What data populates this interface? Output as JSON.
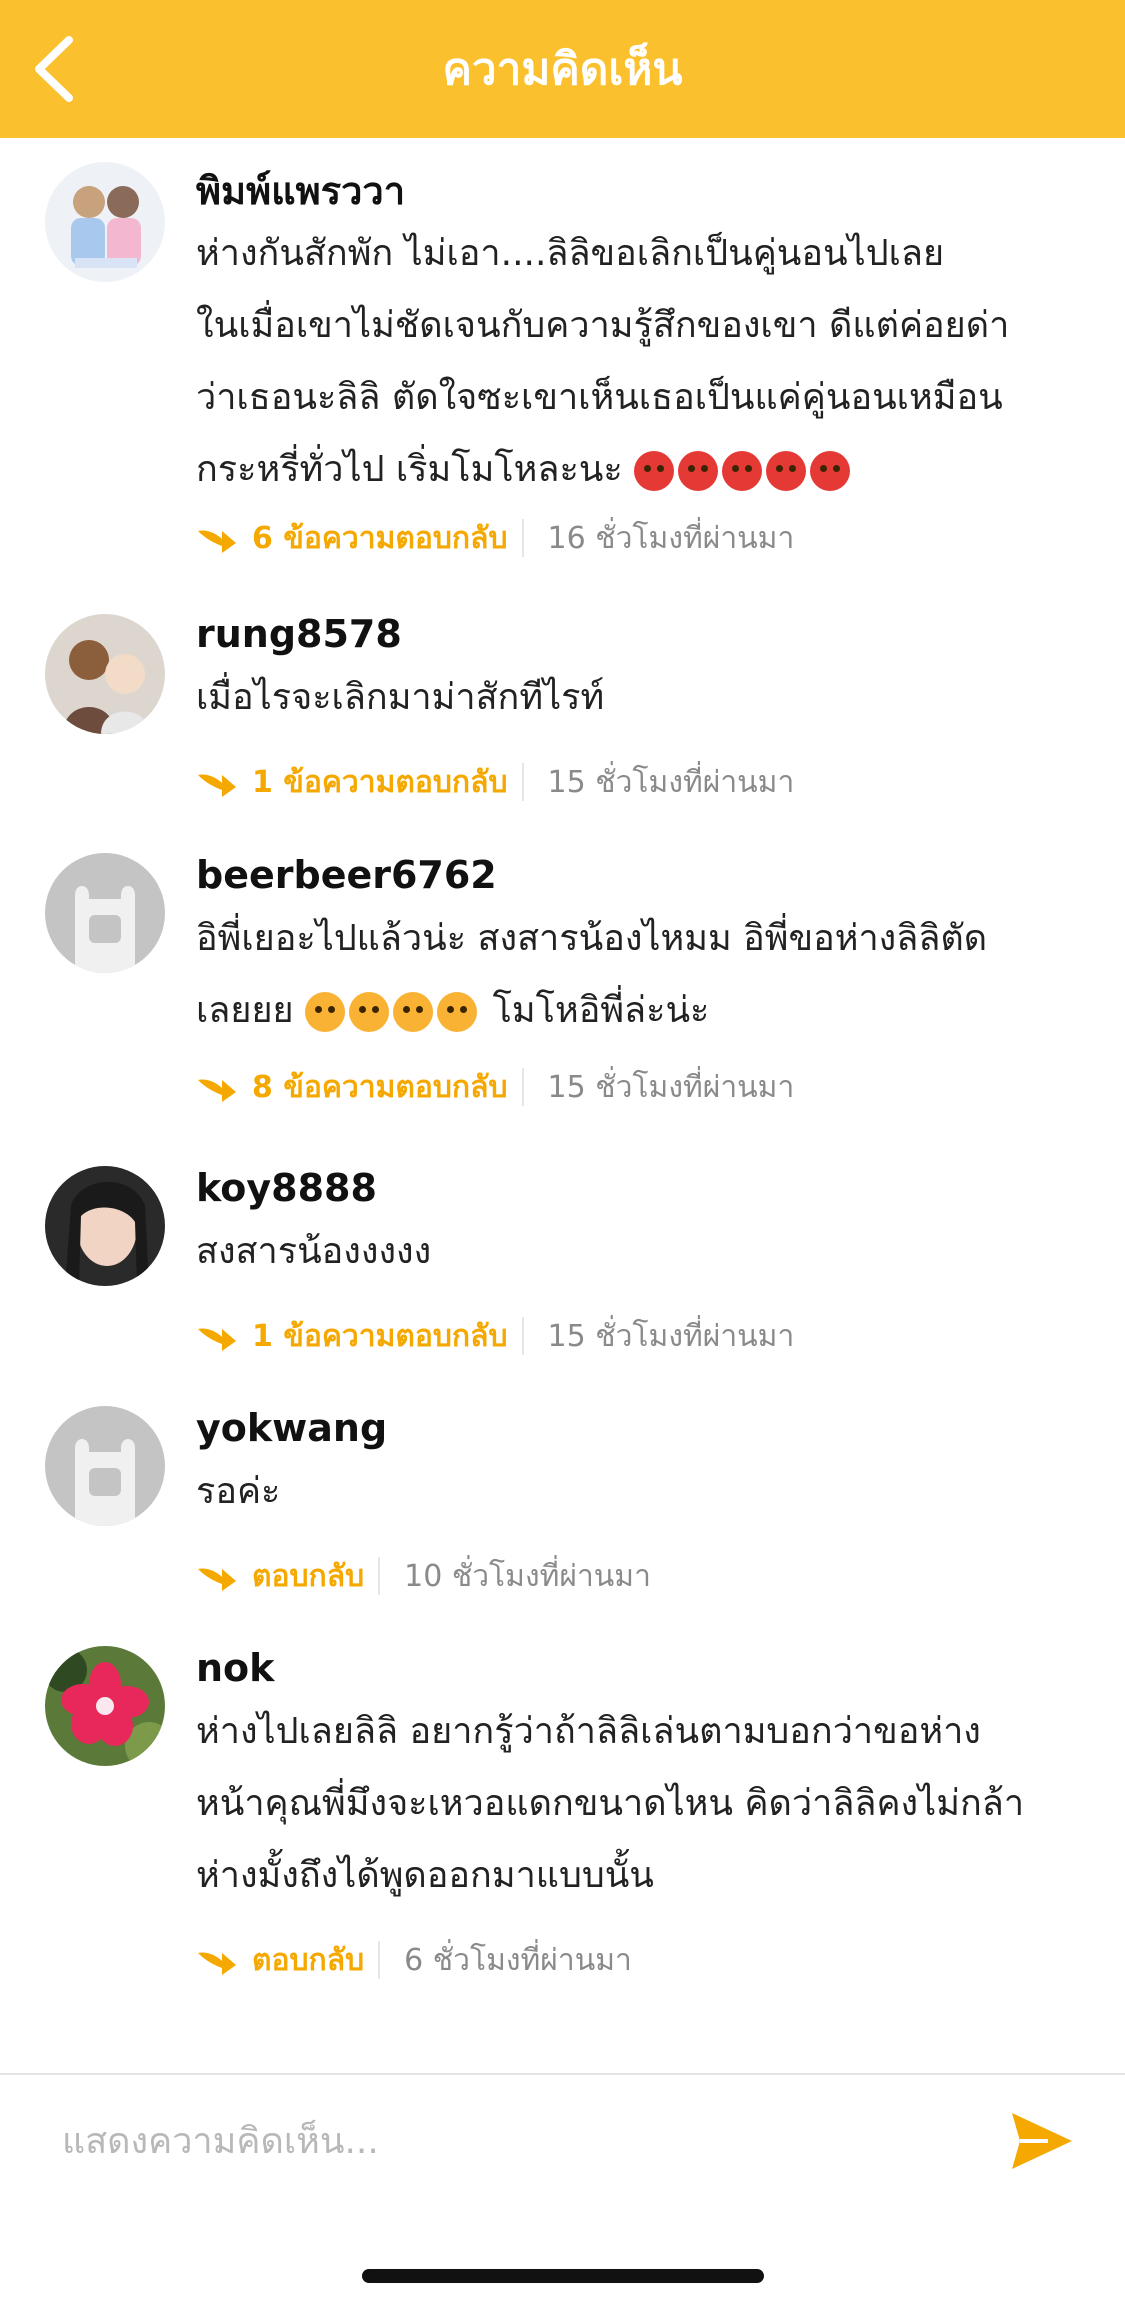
{
  "header": {
    "title": "ความคิดเห็น",
    "back_icon": "chevron-left-icon",
    "background": "#fbc02d"
  },
  "colors": {
    "accent": "#f5a800",
    "muted": "#8a8a8a"
  },
  "comments": [
    {
      "username": "พิมพ์แพรววา",
      "lines": [
        "ห่างกันสักพัก ไม่เอา....ลิลิขอเลิกเป็นคู่นอนไปเลย",
        "ในเมื่อเขาไม่ชัดเจนกับความรู้สึกของเขา ดีแต่ค่อยด่า",
        "ว่าเธอนะลิลิ ตัดใจซะเขาเห็นเธอเป็นแค่คู่นอนเหมือน",
        "กระหรี่ทั่วไป เริ่มโมโหละนะ"
      ],
      "reply_label": "6 ข้อความตอบกลับ",
      "time": "16 ชั่วโมงที่ผ่านมา"
    },
    {
      "username": "rung8578",
      "lines": [
        "เมื่อไรจะเลิกมาม่าสักทีไรท์"
      ],
      "reply_label": "1 ข้อความตอบกลับ",
      "time": "15 ชั่วโมงที่ผ่านมา"
    },
    {
      "username": "beerbeer6762",
      "lines": [
        "อิพี่เยอะไปแล้วน่ะ  สงสารน้องไหมม  อิพี่ขอห่างลิลิตัด",
        "เลยยย"
      ],
      "line2_suffix": "โมโหอิพี่ล่ะน่ะ",
      "reply_label": "8 ข้อความตอบกลับ",
      "time": "15 ชั่วโมงที่ผ่านมา"
    },
    {
      "username": "koy8888",
      "lines": [
        "สงสารน้องงงงง"
      ],
      "reply_label": "1 ข้อความตอบกลับ",
      "time": "15 ชั่วโมงที่ผ่านมา"
    },
    {
      "username": "yokwang",
      "lines": [
        "รอค่ะ"
      ],
      "reply_label": "ตอบกลับ",
      "time": "10 ชั่วโมงที่ผ่านมา"
    },
    {
      "username": "nok",
      "lines": [
        "ห่างไปเลยลิลิ อยากรู้ว่าถ้าลิลิเล่นตามบอกว่าขอห่าง",
        "หน้าคุณพี่มึงจะเหวอแดกขนาดไหน คิดว่าลิลิคงไม่กล้า",
        "ห่างมั้งถึงได้พูดออกมาแบบนั้น"
      ],
      "reply_label": "ตอบกลับ",
      "time": "6 ชั่วโมงที่ผ่านมา"
    }
  ],
  "input": {
    "placeholder": "แสดงความคิดเห็น...",
    "send_icon": "send-icon"
  }
}
